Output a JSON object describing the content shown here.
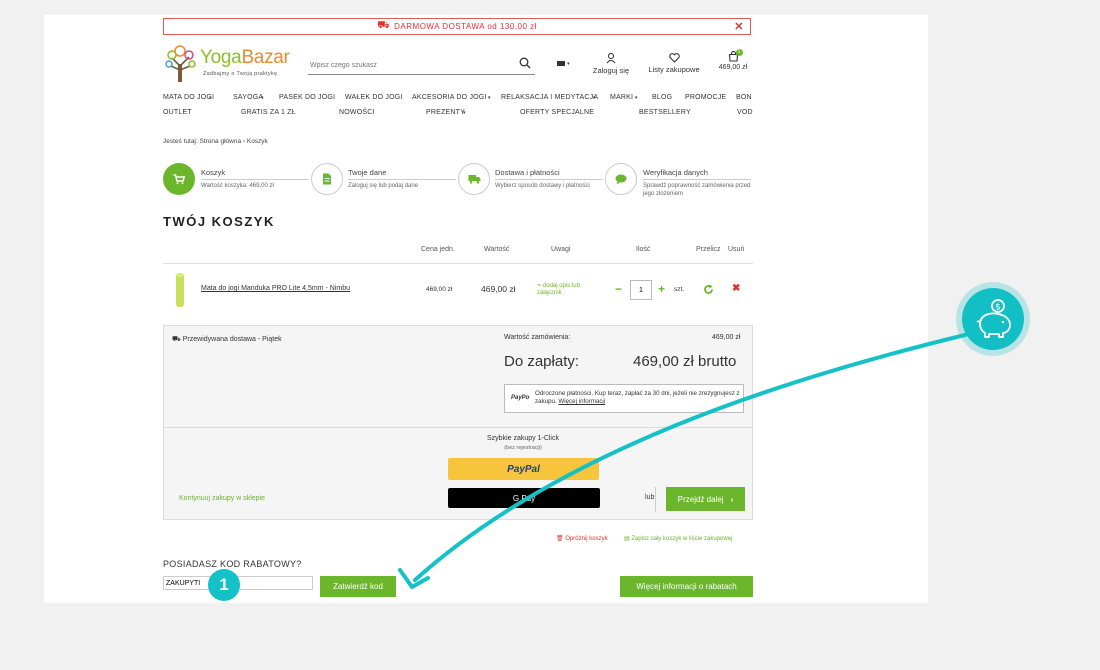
{
  "promo_bar": {
    "text": "DARMOWA DOSTAWA od 130,00 zł"
  },
  "logo": {
    "name_a": "Yoga",
    "name_b": "Bazar",
    "tagline": "Zadbajmy o Twoją praktykę"
  },
  "search": {
    "placeholder": "Wpisz czego szukasz"
  },
  "header": {
    "login": "Zaloguj się",
    "wishlist": "Listy zakupowe",
    "cart_total": "469,00 zł",
    "cart_count": "1"
  },
  "nav_row1": [
    "MATA DO JOGI",
    "SAYOGA",
    "PASEK DO JOGI",
    "WAŁEK DO JOGI",
    "AKCESORIA DO JOGI",
    "RELAKSACJA I MEDYTACJA",
    "MARKI",
    "BLOG",
    "PROMOCJE",
    "BON"
  ],
  "nav_row2": [
    "OUTLET",
    "GRATIS ZA 1 ZŁ",
    "NOWOŚCI",
    "PREZENTY",
    "OFERTY SPECJALNE",
    "BESTSELLERY",
    "VOD"
  ],
  "breadcrumb": {
    "prefix": "Jesteś tutaj:",
    "home": "Strona główna",
    "current": "Koszyk"
  },
  "steps": [
    {
      "title": "Koszyk",
      "sub": "Wartość koszyka: 469,00 zł"
    },
    {
      "title": "Twoje dane",
      "sub": "Zaloguj się lub podaj dane"
    },
    {
      "title": "Dostawa i płatności",
      "sub": "Wybierz sposób dostawy i płatności"
    },
    {
      "title": "Weryfikacja danych",
      "sub": "Sprawdź poprawność zamówienia przed jego złożeniem"
    }
  ],
  "cart_title": "TWÓJ KOSZYK",
  "table_headers": {
    "price": "Cena jedn.",
    "value": "Wartość",
    "notes": "Uwagi",
    "qty": "Ilość",
    "recalc": "Przelicz",
    "remove": "Usuń"
  },
  "item": {
    "name": "Mata do jogi Manduka PRO Lite 4,5mm - Nimbu",
    "price": "469,00 zł",
    "value": "469,00 zł",
    "note": "dodaj opis lub załącznik",
    "qty": "1",
    "unit": "szt."
  },
  "summary": {
    "delivery": "Przewidywana dostawa - Piątek",
    "order_value_label": "Wartość zamówienia:",
    "order_value": "469,00 zł",
    "to_pay_label": "Do zapłaty:",
    "to_pay": "469,00 zł brutto",
    "paypo_logo": "PayPo",
    "paypo_text": "Odroczone płatności. Kup teraz, zapłać za 30 dni, jeżeli nie zrezygnujesz z zakupu.",
    "paypo_link": "Więcej informacji",
    "quick_buy": "Szybkie zakupy 1-Click",
    "quick_buy_sub": "(bez rejestracji)",
    "paypal": "PayPal",
    "gpay": "G Pay",
    "continue": "Kontynuuj zakupy w sklepie",
    "or": "lub",
    "next": "Przejdź dalej"
  },
  "cart_actions": {
    "clear": "Opróżnij koszyk",
    "save": "Zapisz cały koszyk w liście zakupowej"
  },
  "coupon": {
    "question": "POSIADASZ KOD RABATOWY?",
    "value": "ZAKUPYTI",
    "submit": "Zatwierdź kod",
    "more": "Więcej informacji o rabatach"
  },
  "callout": {
    "number": "1"
  },
  "colors": {
    "green": "#6bb62b",
    "teal": "#14c1c6",
    "red": "#d33",
    "paypal_yellow": "#f7c53b"
  }
}
